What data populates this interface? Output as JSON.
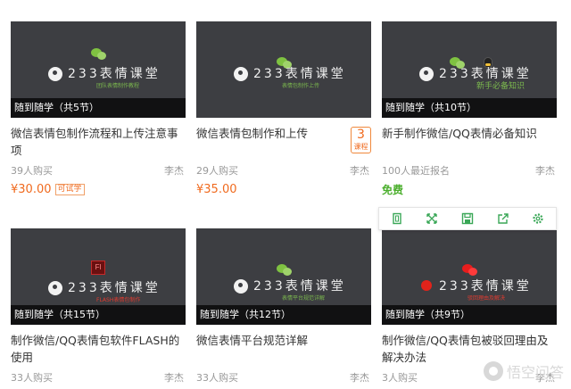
{
  "brand": {
    "logo_text": "233表情课堂"
  },
  "cards": [
    {
      "thumb_sub": "团队表情制作教程",
      "badge": "随到随学（共5节）",
      "title": "微信表情包制作流程和上传注意事项",
      "buyers": "39人购买",
      "teacher": "李杰",
      "price": "¥30.00",
      "trial": "可试学"
    },
    {
      "thumb_sub": "表情包制作上传",
      "badge": "",
      "title": "微信表情包制作和上传",
      "buyers": "29人购买",
      "teacher": "李杰",
      "price": "¥35.00",
      "course_count": "3",
      "course_label": "课程"
    },
    {
      "thumb_sub": "新手必备知识",
      "badge": "随到随学（共10节）",
      "title": "新手制作微信/QQ表情必备知识",
      "buyers": "100人最近报名",
      "teacher": "李杰",
      "free": "免费"
    },
    {
      "thumb_sub": "FLASH表情包制作",
      "badge": "随到随学（共15节）",
      "title": "制作微信/QQ表情包软件FLASH的使用",
      "buyers": "33人购买",
      "teacher": "李杰"
    },
    {
      "thumb_sub": "表情平台规范详解",
      "badge": "随到随学（共12节）",
      "title": "微信表情平台规范详解",
      "buyers": "33人购买",
      "teacher": "李杰"
    },
    {
      "thumb_sub": "驳回理由及解决",
      "badge": "随到随学（共9节）",
      "title": "制作微信/QQ表情包被驳回理由及解决办法",
      "buyers": "3人购买",
      "teacher": "李杰"
    }
  ],
  "toolbar": {
    "icons": [
      "copy-icon",
      "expand-icon",
      "save-icon",
      "share-icon",
      "settings-icon"
    ],
    "color": "#3aa757"
  },
  "watermark": {
    "text": "悟空问答"
  },
  "colors": {
    "price": "#f06a1e",
    "free": "#4caf2e",
    "thumb_bg": "#3d3e42"
  }
}
